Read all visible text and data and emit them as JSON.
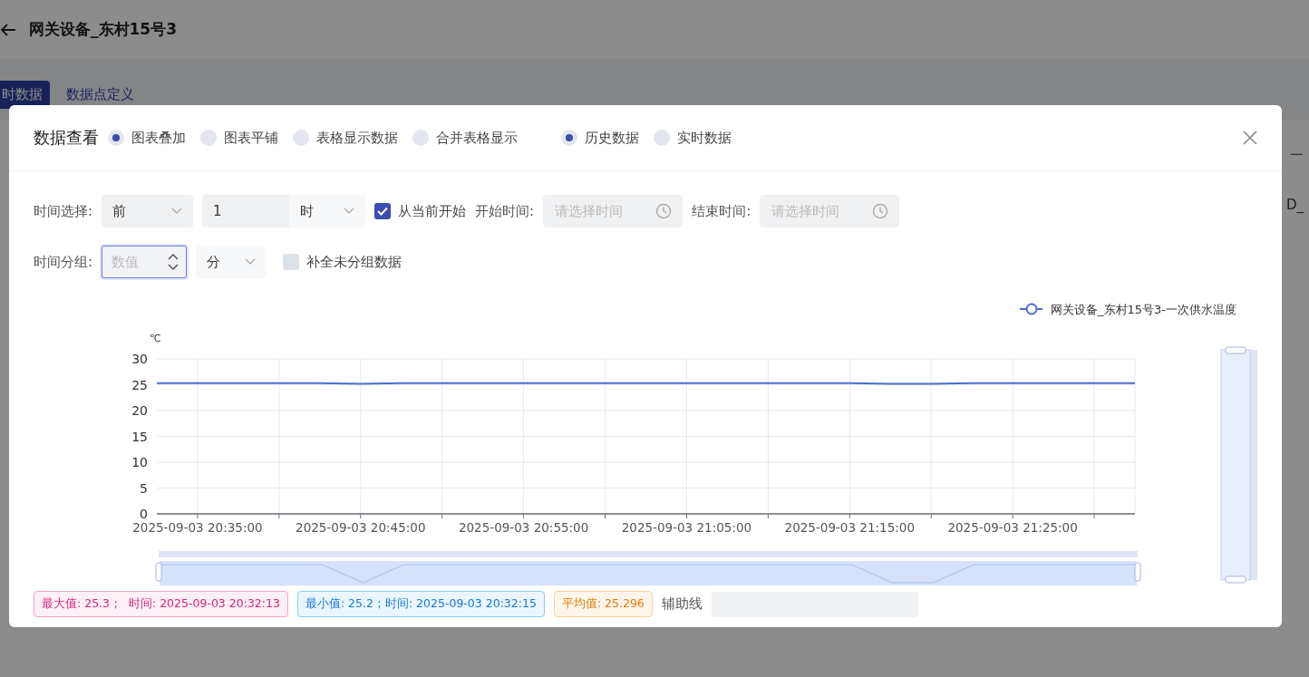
{
  "page": {
    "title": "网关设备_东村15号3",
    "tabs": [
      {
        "label": "时数据",
        "selected": true
      },
      {
        "label": "数据点定义",
        "selected": false
      }
    ],
    "peek_texts": [
      "一",
      "D_"
    ]
  },
  "dialog": {
    "title": "数据查看",
    "view_modes": [
      {
        "label": "图表叠加",
        "selected": true
      },
      {
        "label": "图表平铺",
        "selected": false
      },
      {
        "label": "表格显示数据",
        "selected": false
      },
      {
        "label": "合并表格显示",
        "selected": false
      }
    ],
    "sources": [
      {
        "label": "历史数据",
        "selected": true
      },
      {
        "label": "实时数据",
        "selected": false
      }
    ],
    "time_select": {
      "label": "时间选择:",
      "direction": "前",
      "amount": "1",
      "unit": "时",
      "from_now": {
        "label": "从当前开始",
        "checked": true
      },
      "start": {
        "label": "开始时间:",
        "placeholder": "请选择时间",
        "disabled": true
      },
      "end": {
        "label": "结束时间:",
        "placeholder": "请选择时间",
        "disabled": true
      }
    },
    "time_group": {
      "label": "时间分组:",
      "placeholder": "数值",
      "unit": "分",
      "fill_missing": {
        "label": "补全未分组数据",
        "checked": false
      }
    },
    "chart": {
      "chart_data": {
        "type": "line",
        "ylabel": "℃",
        "categories": [
          null,
          "2025-09-03 20:35:00",
          null,
          null,
          null,
          "2025-09-03 20:45:00",
          null,
          null,
          null,
          "2025-09-03 20:55:00",
          null,
          null,
          null,
          "2025-09-03 21:05:00",
          null,
          null,
          null,
          "2025-09-03 21:15:00",
          null,
          null,
          null,
          "2025-09-03 21:25:00",
          null,
          null,
          null
        ],
        "series": [
          {
            "name": "网关设备_东村15号3-一次供水温度",
            "color": "#4f6bcf",
            "values": [
              25.3,
              25.3,
              25.3,
              25.3,
              25.3,
              25.2,
              25.3,
              25.3,
              25.3,
              25.3,
              25.3,
              25.3,
              25.3,
              25.3,
              25.3,
              25.3,
              25.3,
              25.3,
              25.2,
              25.2,
              25.3,
              25.3,
              25.3,
              25.3,
              25.3
            ]
          }
        ],
        "ylim": [
          0,
          30
        ],
        "grid": true,
        "yticks": [
          0,
          5,
          10,
          15,
          20,
          25,
          30
        ]
      }
    },
    "stats": [
      {
        "kind": "max",
        "text": "最大值: 25.3；  时间: 2025-09-03 20:32:13"
      },
      {
        "kind": "min",
        "text": "最小值: 25.2；时间: 2025-09-03 20:32:15"
      },
      {
        "kind": "avg",
        "text": "平均值: 25.296"
      }
    ],
    "guide_line": {
      "label": "辅助线"
    }
  }
}
